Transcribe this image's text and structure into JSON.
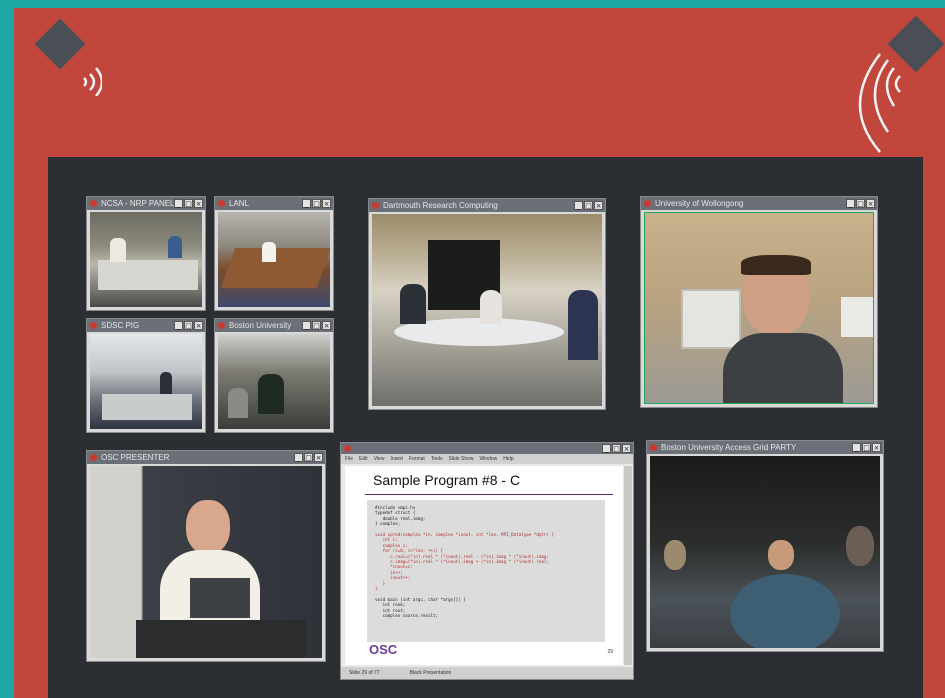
{
  "colors": {
    "border": "#1fa7a6",
    "frame": "#c1463c",
    "wall": "#2b2f33",
    "window_title": "#6b6f78"
  },
  "icons": {
    "left_speaker": "speaker-icon",
    "right_speaker": "speaker-icon"
  },
  "windows": {
    "nasa": {
      "title": "NCSA - NRP PANEL"
    },
    "lanl": {
      "title": "LANL"
    },
    "sdsc": {
      "title": "SDSC PIG"
    },
    "bu_small": {
      "title": "Boston University"
    },
    "dartmouth": {
      "title": "Dartmouth Research Computing"
    },
    "wollongong": {
      "title": "University of Wollongong"
    },
    "osc_presenter": {
      "title": "OSC PRESENTER"
    },
    "bu_access": {
      "title": "Boston University Access Grid PARTY"
    }
  },
  "slide": {
    "title": "Sample Program #8 - C",
    "menu": [
      "File",
      "Edit",
      "View",
      "Insert",
      "Format",
      "Tools",
      "Slide Show",
      "Window",
      "Help"
    ],
    "code_lines": [
      "#include <mpi.h>",
      "typedef struct {",
      "   double real,imag;",
      "} complex;",
      "",
      "void cprod(complex *in, complex *inout, int *len, MPI_Datatype *dptr) {",
      "   int i;",
      "   complex c;",
      "   for (i=0; i<*len; ++i) {",
      "      c.real=(*in).real * (*inout).real - (*in).imag * (*inout).imag;",
      "      c.imag=(*in).real * (*inout).imag + (*in).imag * (*inout).real;",
      "      *inout=c;",
      "      in++;",
      "      inout++;",
      "   }",
      "}",
      "",
      "void main (int argc, char *argv[]) {",
      "   int rank;",
      "   int root;",
      "   complex source,result;"
    ],
    "logo": "OSC",
    "page_number": "29",
    "status_left": "Slide 29 of 77",
    "status_mid": "Black Presentation"
  }
}
